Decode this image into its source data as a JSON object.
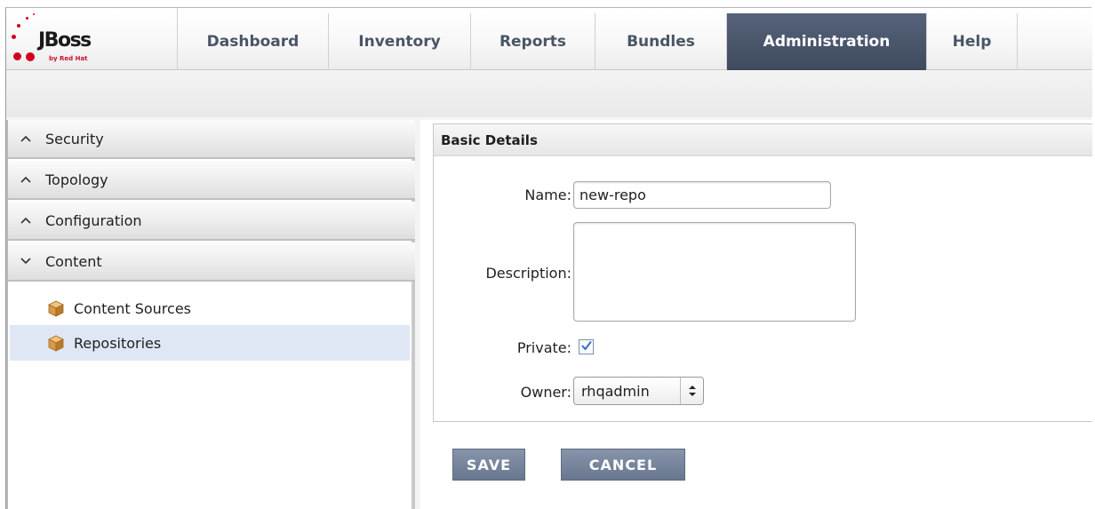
{
  "brand": {
    "logo_text": "JBoss",
    "tagline": "by Red Hat"
  },
  "nav": {
    "tabs": [
      {
        "label": "Dashboard"
      },
      {
        "label": "Inventory"
      },
      {
        "label": "Reports"
      },
      {
        "label": "Bundles"
      },
      {
        "label": "Administration",
        "active": true
      },
      {
        "label": "Help"
      }
    ]
  },
  "sidebar": {
    "sections": [
      {
        "label": "Security",
        "state": "collapsed",
        "icon": "chevron-up-icon"
      },
      {
        "label": "Topology",
        "state": "collapsed",
        "icon": "chevron-up-icon"
      },
      {
        "label": "Configuration",
        "state": "collapsed",
        "icon": "chevron-up-icon"
      },
      {
        "label": "Content",
        "state": "expanded",
        "icon": "chevron-down-icon"
      }
    ],
    "content_items": [
      {
        "label": "Content Sources",
        "icon": "package-icon"
      },
      {
        "label": "Repositories",
        "icon": "package-icon",
        "selected": true
      }
    ]
  },
  "form": {
    "header": "Basic Details",
    "name_label": "Name:",
    "name_value": "new-repo",
    "description_label": "Description:",
    "description_value": "",
    "private_label": "Private:",
    "private_checked": true,
    "owner_label": "Owner:",
    "owner_value": "rhqadmin",
    "save_label": "SAVE",
    "cancel_label": "CANCEL"
  },
  "colors": {
    "active_tab": "#4b576b",
    "button": "#7785a0",
    "selected_row": "#dfe7f5",
    "brand_red": "#c8102e"
  }
}
